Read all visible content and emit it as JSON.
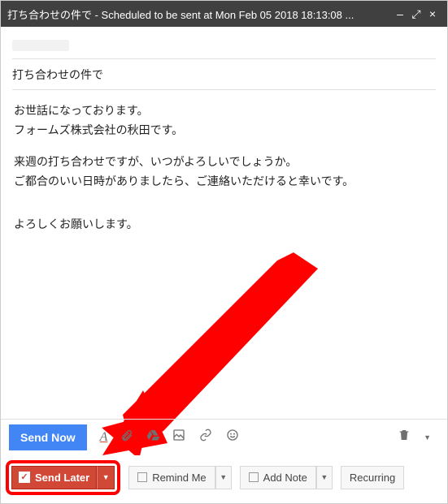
{
  "titlebar": {
    "title": "打ち合わせの件で - Scheduled to be sent at Mon Feb 05 2018 18:13:08 ..."
  },
  "compose": {
    "subject": "打ち合わせの件で",
    "body": {
      "l1": "お世話になっております。",
      "l2": "フォームズ株式会社の秋田です。",
      "l3": "来週の打ち合わせですが、いつがよろしいでしょうか。",
      "l4": "ご都合のいい日時がありましたら、ご連絡いただけると幸いです。",
      "l5": "よろしくお願いします。"
    }
  },
  "toolbar1": {
    "send_now": "Send Now",
    "format_icon": "A",
    "attach_icon": "📎",
    "drive_icon": "△",
    "photo_icon": "▣",
    "link_icon": "🔗",
    "emoji_icon": "☺",
    "trash_icon": "🗑",
    "more_icon": "▾"
  },
  "toolbar2": {
    "send_later": "Send Later",
    "remind_me": "Remind Me",
    "add_note": "Add Note",
    "recurring": "Recurring"
  }
}
